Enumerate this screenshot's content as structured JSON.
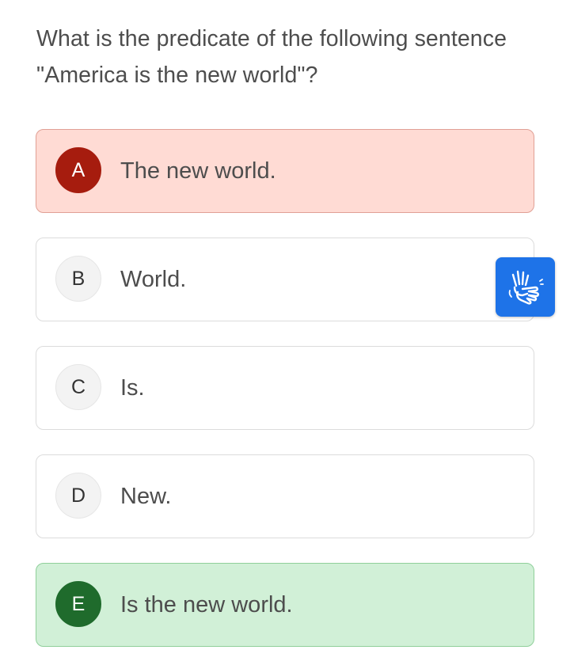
{
  "question": {
    "text": "What is the predicate of the following sentence \"America is the new world\"?"
  },
  "options": [
    {
      "letter": "A",
      "text": "The new world.",
      "state": "wrong"
    },
    {
      "letter": "B",
      "text": "World.",
      "state": "neutral"
    },
    {
      "letter": "C",
      "text": "Is.",
      "state": "neutral"
    },
    {
      "letter": "D",
      "text": "New.",
      "state": "neutral"
    },
    {
      "letter": "E",
      "text": "Is the new world.",
      "state": "correct"
    }
  ],
  "accessibility": {
    "icon": "sign-language-icon",
    "color": "#1e73e8"
  },
  "colors": {
    "wrong_bg": "#ffdbd4",
    "wrong_badge": "#a61c0e",
    "correct_bg": "#d1f0d7",
    "correct_badge": "#1f6b2c"
  }
}
